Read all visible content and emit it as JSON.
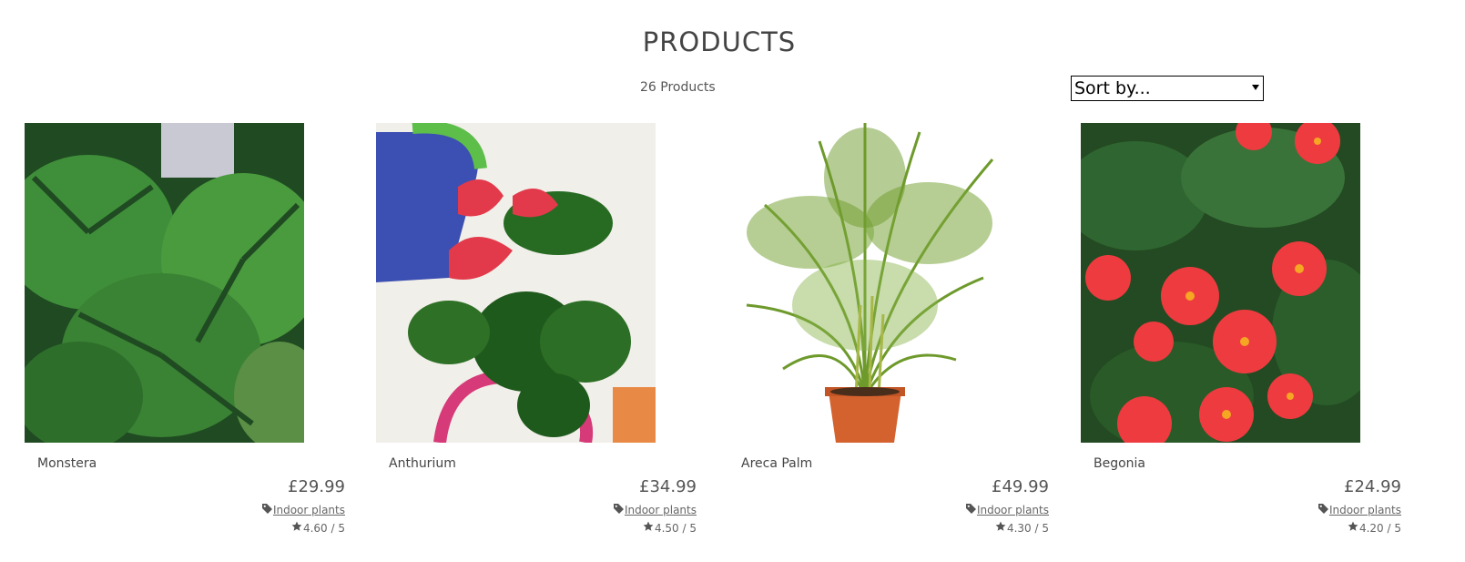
{
  "page": {
    "title": "PRODUCTS",
    "count": "26 Products"
  },
  "sort": {
    "selected": "Sort by..."
  },
  "products": [
    {
      "name": "Monstera",
      "price": "£29.99",
      "category": "Indoor plants",
      "rating": "4.60 / 5"
    },
    {
      "name": "Anthurium",
      "price": "£34.99",
      "category": "Indoor plants",
      "rating": "4.50 / 5"
    },
    {
      "name": "Areca Palm",
      "price": "£49.99",
      "category": "Indoor plants",
      "rating": "4.30 / 5"
    },
    {
      "name": "Begonia",
      "price": "£24.99",
      "category": "Indoor plants",
      "rating": "4.20 / 5"
    }
  ]
}
